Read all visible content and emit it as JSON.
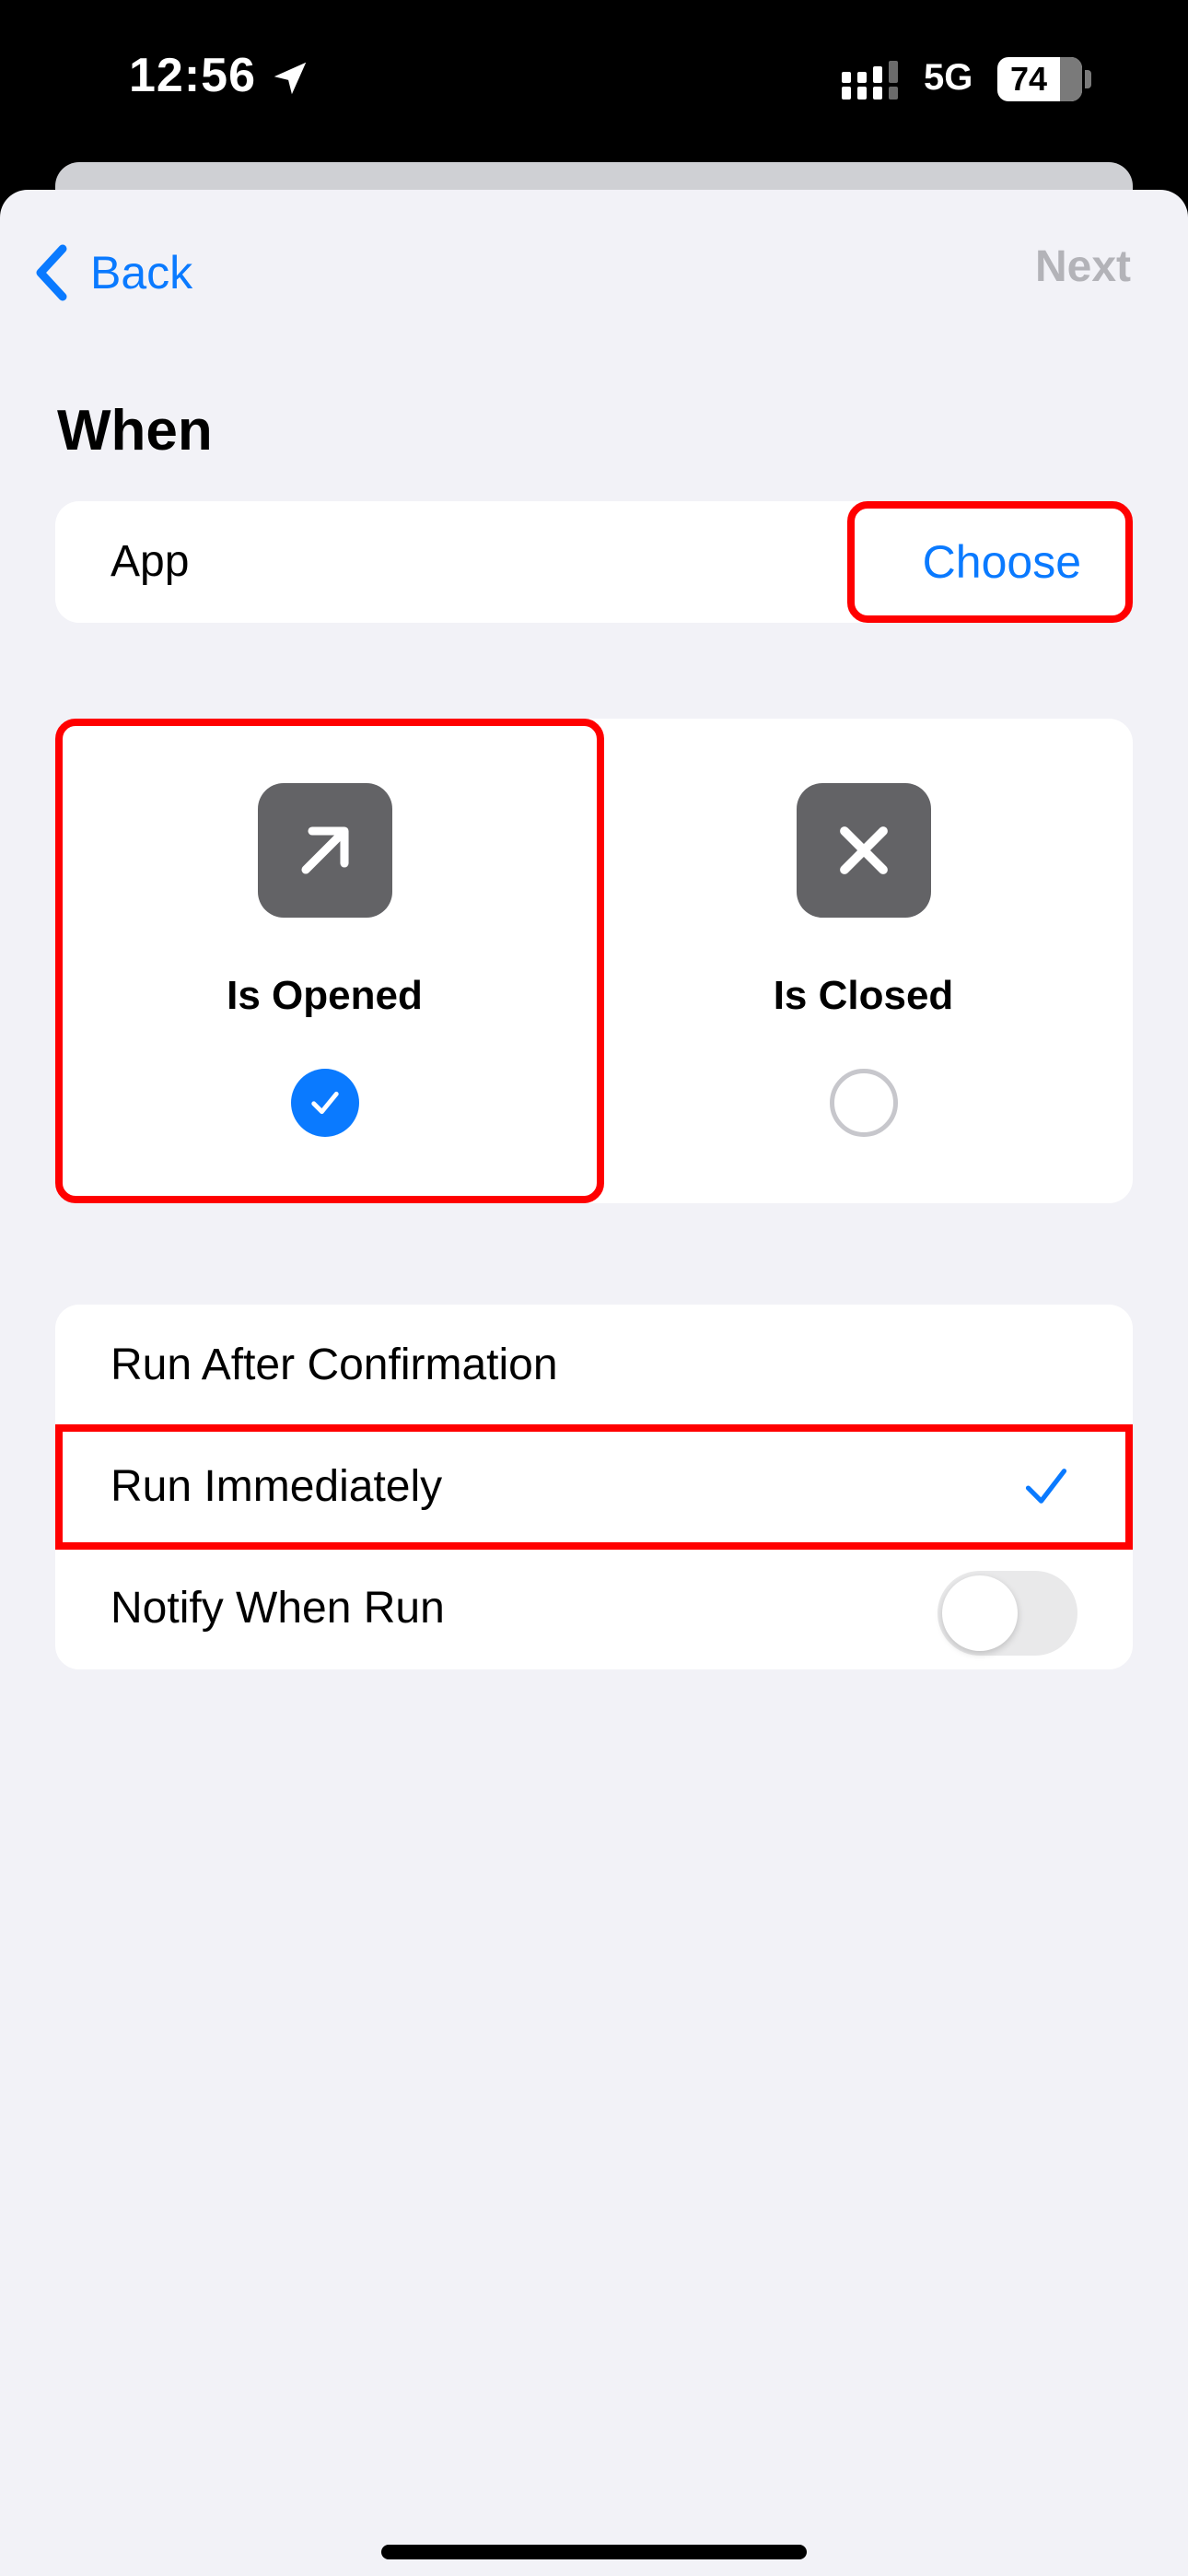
{
  "status_bar": {
    "time": "12:56",
    "network": "5G",
    "battery": "74"
  },
  "nav": {
    "back_label": "Back",
    "next_label": "Next"
  },
  "section": {
    "title": "When"
  },
  "app_row": {
    "label": "App",
    "action": "Choose"
  },
  "app_state": {
    "options": [
      {
        "label": "Is Opened",
        "icon": "arrow-up-right-icon",
        "selected": true
      },
      {
        "label": "Is Closed",
        "icon": "x-mark-icon",
        "selected": false
      }
    ]
  },
  "run_options": {
    "rows": [
      {
        "label": "Run After Confirmation",
        "checked": false
      },
      {
        "label": "Run Immediately",
        "checked": true
      }
    ],
    "notify": {
      "label": "Notify When Run",
      "on": false
    }
  },
  "colors": {
    "accent": "#0a7aff",
    "highlight": "#ff0000",
    "disabled": "#b3b3b8",
    "icon_bg": "#636366"
  }
}
